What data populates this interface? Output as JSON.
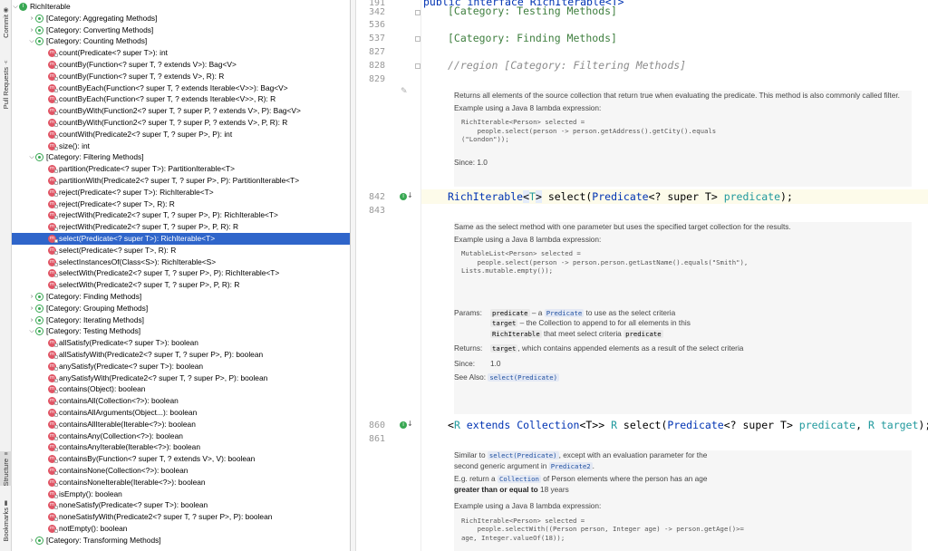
{
  "sidebar_tabs": {
    "commit": "Commit",
    "pull_requests": "Pull Requests",
    "structure": "Structure",
    "bookmarks": "Bookmarks"
  },
  "tree": {
    "rows": [
      {
        "label": "RichIterable",
        "icon": "ci",
        "depth": 0,
        "arrow": "down"
      },
      {
        "label": "[Category: Aggregating Methods]",
        "icon": "cat",
        "depth": 1,
        "arrow": "right"
      },
      {
        "label": "[Category: Converting Methods]",
        "icon": "cat",
        "depth": 1,
        "arrow": "right"
      },
      {
        "label": "[Category: Counting Methods]",
        "icon": "cat",
        "depth": 1,
        "arrow": "down"
      },
      {
        "label": "count(Predicate<? super T>): int",
        "icon": "m",
        "depth": 2
      },
      {
        "label": "countBy(Function<? super T, ? extends V>): Bag<V>",
        "icon": "m",
        "depth": 2
      },
      {
        "label": "countBy(Function<? super T, ? extends V>, R): R",
        "icon": "m",
        "depth": 2
      },
      {
        "label": "countByEach(Function<? super T, ? extends Iterable<V>>): Bag<V>",
        "icon": "m",
        "depth": 2
      },
      {
        "label": "countByEach(Function<? super T, ? extends Iterable<V>>, R): R",
        "icon": "m",
        "depth": 2
      },
      {
        "label": "countByWith(Function2<? super T, ? super P, ? extends V>, P): Bag<V>",
        "icon": "m",
        "depth": 2
      },
      {
        "label": "countByWith(Function2<? super T, ? super P, ? extends V>, P, R): R",
        "icon": "m",
        "depth": 2
      },
      {
        "label": "countWith(Predicate2<? super T, ? super P>, P): int",
        "icon": "m",
        "depth": 2
      },
      {
        "label": "size(): int",
        "icon": "m",
        "depth": 2
      },
      {
        "label": "[Category: Filtering Methods]",
        "icon": "cat",
        "depth": 1,
        "arrow": "down"
      },
      {
        "label": "partition(Predicate<? super T>): PartitionIterable<T>",
        "icon": "m",
        "depth": 2
      },
      {
        "label": "partitionWith(Predicate2<? super T, ? super P>, P): PartitionIterable<T>",
        "icon": "m",
        "depth": 2
      },
      {
        "label": "reject(Predicate<? super T>): RichIterable<T>",
        "icon": "m",
        "depth": 2
      },
      {
        "label": "reject(Predicate<? super T>, R): R",
        "icon": "m",
        "depth": 2
      },
      {
        "label": "rejectWith(Predicate2<? super T, ? super P>, P): RichIterable<T>",
        "icon": "m",
        "depth": 2
      },
      {
        "label": "rejectWith(Predicate2<? super T, ? super P>, P, R): R",
        "icon": "m",
        "depth": 2
      },
      {
        "label": "select(Predicate<? super T>): RichIterable<T>",
        "icon": "m",
        "depth": 2,
        "selected": true
      },
      {
        "label": "select(Predicate<? super T>, R): R",
        "icon": "m",
        "depth": 2
      },
      {
        "label": "selectInstancesOf(Class<S>): RichIterable<S>",
        "icon": "m",
        "depth": 2
      },
      {
        "label": "selectWith(Predicate2<? super T, ? super P>, P): RichIterable<T>",
        "icon": "m",
        "depth": 2
      },
      {
        "label": "selectWith(Predicate2<? super T, ? super P>, P, R): R",
        "icon": "m",
        "depth": 2
      },
      {
        "label": "[Category: Finding Methods]",
        "icon": "cat",
        "depth": 1,
        "arrow": "right"
      },
      {
        "label": "[Category: Grouping Methods]",
        "icon": "cat",
        "depth": 1,
        "arrow": "right"
      },
      {
        "label": "[Category: Iterating Methods]",
        "icon": "cat",
        "depth": 1,
        "arrow": "right"
      },
      {
        "label": "[Category: Testing Methods]",
        "icon": "cat",
        "depth": 1,
        "arrow": "down"
      },
      {
        "label": "allSatisfy(Predicate<? super T>): boolean",
        "icon": "m",
        "depth": 2
      },
      {
        "label": "allSatisfyWith(Predicate2<? super T, ? super P>, P): boolean",
        "icon": "m",
        "depth": 2
      },
      {
        "label": "anySatisfy(Predicate<? super T>): boolean",
        "icon": "m",
        "depth": 2
      },
      {
        "label": "anySatisfyWith(Predicate2<? super T, ? super P>, P): boolean",
        "icon": "m",
        "depth": 2
      },
      {
        "label": "contains(Object): boolean",
        "icon": "m",
        "depth": 2
      },
      {
        "label": "containsAll(Collection<?>): boolean",
        "icon": "m",
        "depth": 2
      },
      {
        "label": "containsAllArguments(Object...): boolean",
        "icon": "m",
        "depth": 2
      },
      {
        "label": "containsAllIterable(Iterable<?>): boolean",
        "icon": "m",
        "depth": 2
      },
      {
        "label": "containsAny(Collection<?>): boolean",
        "icon": "m",
        "depth": 2
      },
      {
        "label": "containsAnyIterable(Iterable<?>): boolean",
        "icon": "m",
        "depth": 2
      },
      {
        "label": "containsBy(Function<? super T, ? extends V>, V): boolean",
        "icon": "m",
        "depth": 2
      },
      {
        "label": "containsNone(Collection<?>): boolean",
        "icon": "m",
        "depth": 2
      },
      {
        "label": "containsNoneIterable(Iterable<?>): boolean",
        "icon": "m",
        "depth": 2
      },
      {
        "label": "isEmpty(): boolean",
        "icon": "m",
        "depth": 2
      },
      {
        "label": "noneSatisfy(Predicate<? super T>): boolean",
        "icon": "m",
        "depth": 2
      },
      {
        "label": "noneSatisfyWith(Predicate2<? super T, ? super P>, P): boolean",
        "icon": "m",
        "depth": 2
      },
      {
        "label": "notEmpty(): boolean",
        "icon": "m",
        "depth": 2
      },
      {
        "label": "[Category: Transforming Methods]",
        "icon": "cat",
        "depth": 1,
        "arrow": "right"
      }
    ]
  },
  "editor": {
    "line_numbers": [
      "191",
      "342",
      "536",
      "537",
      "827",
      "828",
      "829",
      "842",
      "843",
      "860",
      "861"
    ],
    "header_code": "public interface RichIterable<T>",
    "cat_testing": "[Category: Testing Methods]",
    "cat_finding": "[Category: Finding Methods]",
    "region_filtering": "//region [Category: Filtering Methods]",
    "doc1": {
      "text": "Returns all elements of the source collection that return true when evaluating the predicate. This method is also commonly called filter.",
      "example_label": "Example using a Java 8 lambda expression:",
      "code": "RichIterable<Person> selected =\n    people.select(person -> person.getAddress().getCity().equals\n(\"London\"));",
      "since": "Since: 1.0"
    },
    "sig842": {
      "ret": "RichIterable",
      "gen_open": "<",
      "gen_t": "T",
      "gen_close": ">",
      "name": " select(",
      "ptype": "Predicate",
      "pgen": "<? super T>",
      "pname": " predicate",
      ",end": ");",
      "end": ");"
    },
    "doc2": {
      "text": "Same as the select method with one parameter but uses the specified target collection for the results.",
      "example_label": "Example using a Java 8 lambda expression:",
      "code": "MutableList<Person> selected =\n    people.select(person -> person.person.getLastName().equals(\"Smith\"),\nLists.mutable.empty());",
      "params_label": "Params:",
      "p1_name": "predicate",
      "p1_a": " – a ",
      "p1_chip": "Predicate",
      "p1_b": " to use as the select criteria",
      "p2_name": "target",
      "p2_text": " – the Collection to append to for all elements in this",
      "p2_chip": "RichIterable",
      "p2_text2": " that meet select criteria ",
      "p2_chip2": "predicate",
      "returns_label": "Returns:",
      "r_chip": "target",
      "r_text": ", which contains appended elements as a result of the select criteria",
      "since_label": "Since:",
      "since_val": "1.0",
      "see_label": "See Also:",
      "see_chip": "select(Predicate)"
    },
    "sig860": {
      "a": "<",
      "r": "R",
      "ext": " extends ",
      "coll": "Collection",
      "b": "<T>>",
      "r2": " R ",
      "name": "select(",
      "ptype": "Predicate",
      "pgen": "<? super T>",
      "pname": " predicate",
      "comma": ", ",
      "rt": "R",
      "tname": " target",
      "end": ");"
    },
    "doc3": {
      "l1a": "Similar to ",
      "l1chip": "select(Predicate)",
      "l1b": ", except with an evaluation parameter for the",
      "l2a": "second generic argument in ",
      "l2chip": "Predicate2",
      "l2b": ".",
      "l3a": "E.g. return a ",
      "l3chip": "Collection",
      "l3b": " of Person elements where the person has an age",
      "l4b": "greater than or equal to",
      "l4c": " 18 years",
      "example_label": "Example using a Java 8 lambda expression:",
      "code": "RichIterable<Person> selected =\n    people.selectWith((Person person, Integer age) -> person.getAge()>=\nage, Integer.valueOf(18));"
    }
  }
}
